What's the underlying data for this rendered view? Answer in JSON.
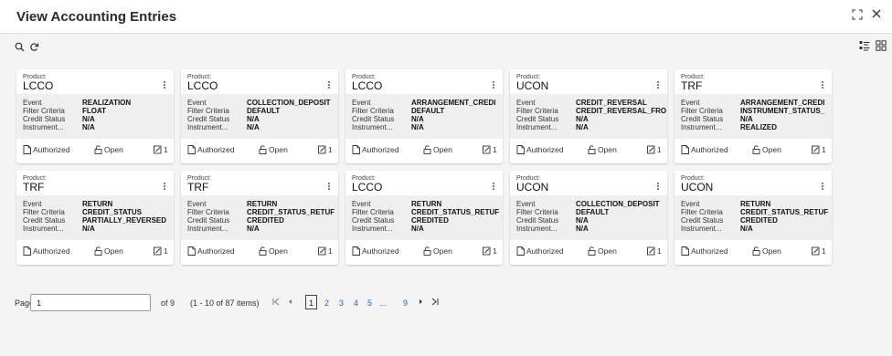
{
  "window": {
    "title": "View Accounting Entries",
    "expand_icon": "expand-icon",
    "close_icon": "close-icon"
  },
  "toolbar": {
    "search_icon": "search-icon",
    "refresh_icon": "refresh-icon"
  },
  "view_switch": {
    "list_icon": "list-view-icon",
    "grid_icon": "grid-view-icon"
  },
  "labels": {
    "product": "Product:",
    "event": "Event",
    "filter_criteria": "Filter Criteria",
    "credit_status": "Credit Status",
    "instrument": "Instrument...",
    "authorized": "Authorized",
    "open": "Open"
  },
  "cards": [
    {
      "product": "LCCO",
      "event": "REALIZATION",
      "filter": "FLOAT",
      "credit_status": "N/A",
      "instrument": "N/A",
      "count": "1"
    },
    {
      "product": "LCCO",
      "event": "COLLECTION_DEPOSIT",
      "filter": "DEFAULT",
      "credit_status": "N/A",
      "instrument": "N/A",
      "count": "1"
    },
    {
      "product": "LCCO",
      "event": "ARRANGEMENT_CREDI",
      "filter": "DEFAULT",
      "credit_status": "N/A",
      "instrument": "N/A",
      "count": "1"
    },
    {
      "product": "UCON",
      "event": "CREDIT_REVERSAL",
      "filter": "CREDIT_REVERSAL_FRO",
      "credit_status": "N/A",
      "instrument": "N/A",
      "count": "1"
    },
    {
      "product": "TRF",
      "event": "ARRANGEMENT_CREDI",
      "filter": "INSTRUMENT_STATUS_",
      "credit_status": "N/A",
      "instrument": "REALIZED",
      "count": "1"
    },
    {
      "product": "TRF",
      "event": "RETURN",
      "filter": "CREDIT_STATUS",
      "credit_status": "PARTIALLY_REVERSED",
      "instrument": "N/A",
      "count": "1"
    },
    {
      "product": "TRF",
      "event": "RETURN",
      "filter": "CREDIT_STATUS_RETUF",
      "credit_status": "CREDITED",
      "instrument": "N/A",
      "count": "1"
    },
    {
      "product": "LCCO",
      "event": "RETURN",
      "filter": "CREDIT_STATUS_RETUF",
      "credit_status": "CREDITED",
      "instrument": "N/A",
      "count": "1"
    },
    {
      "product": "UCON",
      "event": "COLLECTION_DEPOSIT",
      "filter": "DEFAULT",
      "credit_status": "N/A",
      "instrument": "N/A",
      "count": "1"
    },
    {
      "product": "UCON",
      "event": "RETURN",
      "filter": "CREDIT_STATUS_RETUF",
      "credit_status": "CREDITED",
      "instrument": "N/A",
      "count": "1"
    }
  ],
  "pagination": {
    "page_label": "Page",
    "page_value": "1",
    "of_text": "of 9",
    "items_text": "(1 - 10 of 87 items)",
    "first_icon": "first-page-icon",
    "prev_icon": "prev-page-icon",
    "pages": [
      "1",
      "2",
      "3",
      "4",
      "5",
      "...",
      "9"
    ],
    "current_page": "1",
    "next_icon": "next-page-icon",
    "last_icon": "last-page-icon"
  }
}
